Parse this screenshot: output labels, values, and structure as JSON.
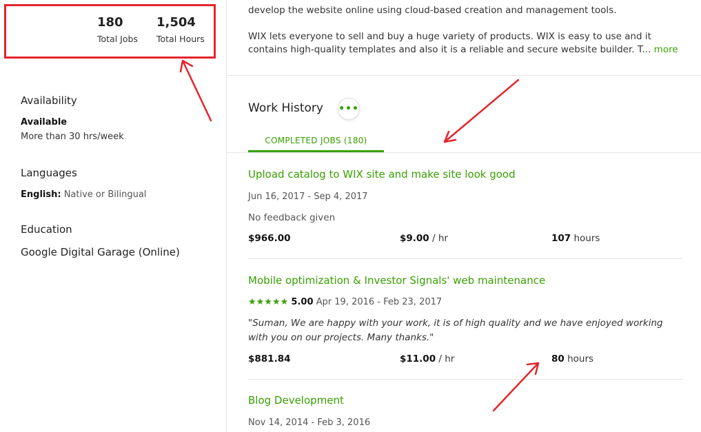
{
  "stats": {
    "total_jobs": "180",
    "total_jobs_label": "Total Jobs",
    "total_hours": "1,504",
    "total_hours_label": "Total Hours"
  },
  "availability": {
    "title": "Availability",
    "status": "Available",
    "detail": "More than 30 hrs/week"
  },
  "languages": {
    "title": "Languages",
    "name": "English:",
    "level": "Native or Bilingual"
  },
  "education": {
    "title": "Education",
    "school": "Google Digital Garage (Online)"
  },
  "description": {
    "line1": "develop the website online using cloud-based creation and management tools.",
    "para2": "WIX lets everyone to sell and buy a huge variety of products. WIX is easy to use and it contains high-quality templates and also it is a reliable and secure website builder. T...",
    "more": "more"
  },
  "work_history": {
    "title": "Work History",
    "menu_glyph": "•••",
    "tab": "COMPLETED JOBS (180)",
    "jobs": [
      {
        "title": "Upload catalog to WIX site and make site look good",
        "dates": "Jun 16, 2017 - Sep 4, 2017",
        "feedback": "No feedback given",
        "earned": "$966.00",
        "rate": "$9.00",
        "rate_unit": "/ hr",
        "hours": "107",
        "hours_unit": "hours"
      },
      {
        "title": "Mobile optimization & Investor Signals' web maintenance",
        "rating_stars": "★★★★★",
        "rating": "5.00",
        "dates": "Apr 19, 2016 - Feb 23, 2017",
        "feedback": "\"Suman, We are happy with your work, it is of high quality and we have enjoyed working with you on our projects. Many thanks.\"",
        "earned": "$881.84",
        "rate": "$11.00",
        "rate_unit": "/ hr",
        "hours": "80",
        "hours_unit": "hours"
      },
      {
        "title": "Blog Development",
        "dates": "Nov 14, 2014 - Feb 3, 2016"
      }
    ]
  },
  "colors": {
    "accent": "#37a000",
    "annotation": "#e3242b"
  }
}
